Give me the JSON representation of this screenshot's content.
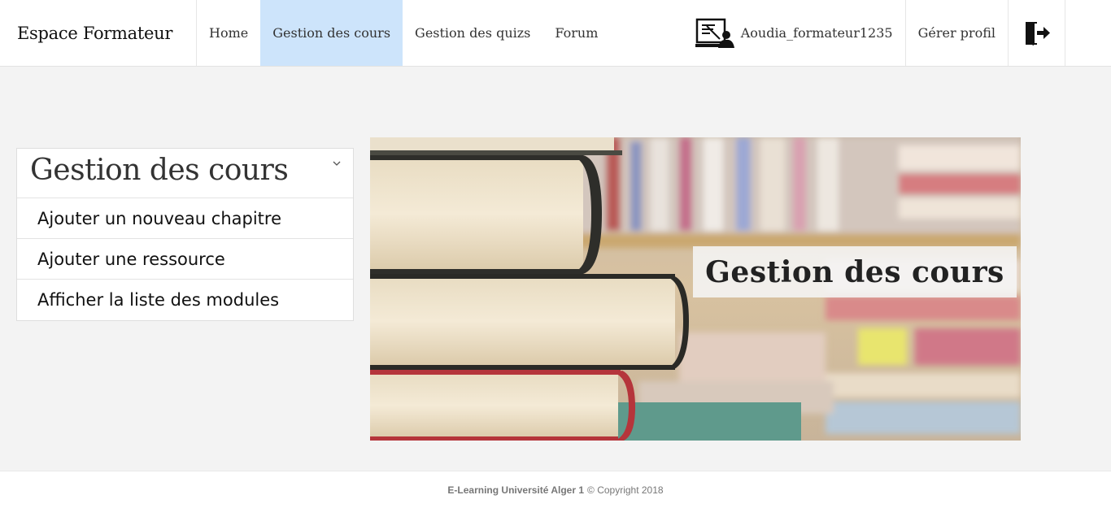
{
  "nav": {
    "brand": "Espace Formateur",
    "links": [
      {
        "label": "Home",
        "active": false
      },
      {
        "label": "Gestion des cours",
        "active": true
      },
      {
        "label": "Gestion des quizs",
        "active": false
      },
      {
        "label": "Forum",
        "active": false
      }
    ],
    "user_name": "Aoudia_formateur1235",
    "profile_label": "Gérer profil",
    "active_color": "#cde4fb"
  },
  "sidebar": {
    "title": "Gestion des cours",
    "items": [
      {
        "label": "Ajouter un nouveau chapitre"
      },
      {
        "label": "Ajouter une ressource"
      },
      {
        "label": "Afficher la liste des modules"
      }
    ]
  },
  "banner": {
    "label": "Gestion des cours"
  },
  "footer": {
    "brand": "E-Learning Université Alger 1",
    "copyright": "© Copyright 2018"
  }
}
